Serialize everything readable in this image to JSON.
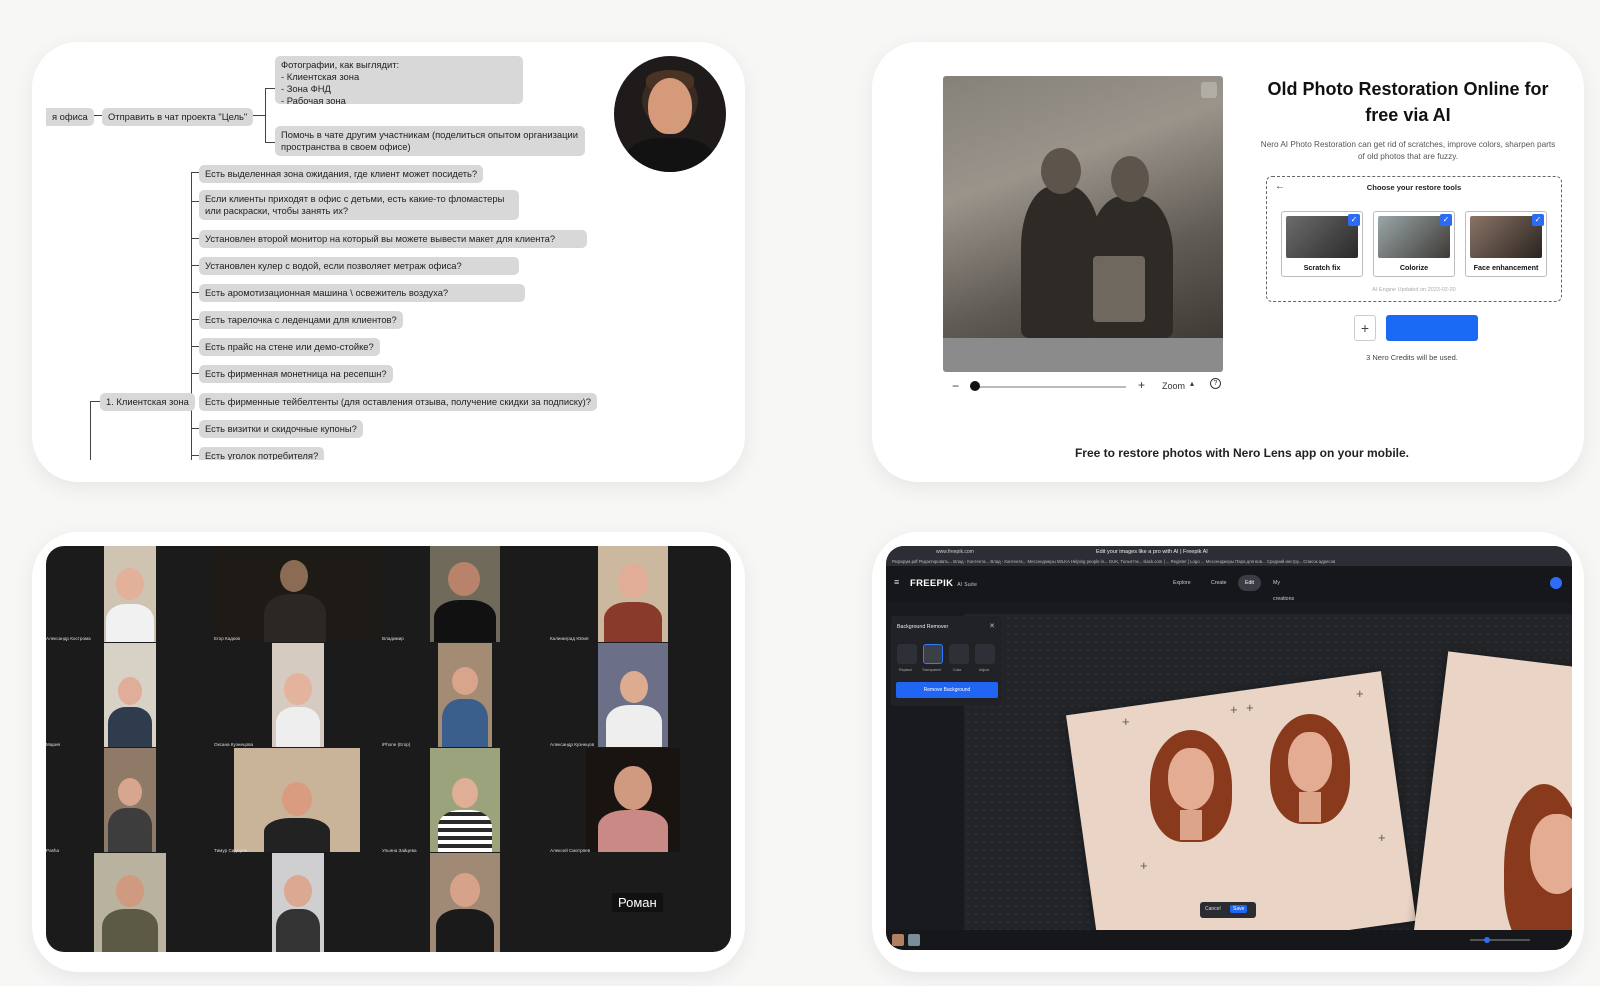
{
  "mindmap": {
    "root_left": "я офиса",
    "send_chat": "Отправить в чат проекта \"Цель\"",
    "photos_note": [
      "Фотографии, как выглядит:",
      "- Клиентская зона",
      "- Зона ФНД",
      "- Рабочая зона"
    ],
    "help_note": "Помочь в чате другим участникам (поделиться опытом организации пространства в своем офисе)",
    "client_zone": "1. Клиентская зона",
    "items": [
      "Есть выделенная зона ожидания, где клиент может посидеть?",
      "Если клиенты приходят в офис с детьми, есть какие-то фломастеры или раскраски, чтобы занять их?",
      "Установлен второй монитор на который вы можете вывести макет для клиента?",
      "Установлен кулер с водой, если позволяет метраж офиса?",
      "Есть аромотизационная машина \\ освежитель воздуха?",
      "Есть тарелочка с леденцами для клиентов?",
      "Есть прайс на стене или демо-стойке?",
      "Есть фирменная монетница на ресепшн?",
      "Есть фирменные тейбелтенты (для оставления отзыва, получение скидки за подписку)?",
      "Есть визитки и скидочные купоны?",
      "Есть уголок потребителя?"
    ]
  },
  "restore": {
    "title": "Old Photo Restoration Online for free via AI",
    "description": "Nero AI Photo Restoration can get rid of scratches, improve colors, sharpen parts of old photos that are fuzzy.",
    "choose_tools": "Choose your restore tools",
    "tools": [
      "Scratch fix",
      "Colorize",
      "Face enhancement"
    ],
    "engine_note": "AI Engine Updated on 2023-02-20",
    "credits_note": "3 Nero Credits will be used.",
    "zoom_label": "Zoom",
    "footer": "Free to restore photos with Nero Lens app on your mobile."
  },
  "videocall": {
    "names": [
      "Александр Кострома",
      "Егор Кадков",
      "Владимир",
      "Калиниград Юлия",
      "Мария",
      "Оксана Кузнецова",
      "iPhone (Егор)",
      "Александр Кузнецов",
      "Pasha",
      "Тимур Сидоров",
      "Ульяна Зайцева",
      "Алексей Смотряев"
    ],
    "speaker_label": "Роман"
  },
  "freepik": {
    "url": "www.freepik.com",
    "tab_title": "Edit your images like a pro with AI | Freepik AI",
    "bookmarks": "Рефорум.pdf   Редактировать...   Влад - Контента...   Влад - Контента...   Мессенджеры   MILKA   Helping people in...   GUK, Тольятти...   slack.com | ...   Register | Logo ...   Мессенджеры   Пара для вов...   Средний инстру...   Список адресов",
    "logo": "FREEPIK",
    "logo_suffix": "AI Suite",
    "nav": [
      "Explore",
      "Create",
      "Edit",
      "My creations"
    ],
    "panel_title": "Background Remover",
    "panel_tools": [
      "Replace",
      "Transparent",
      "Color",
      "Adjust"
    ],
    "remove_button": "Remove Background",
    "cancel": "Cancel",
    "save": "Save"
  }
}
